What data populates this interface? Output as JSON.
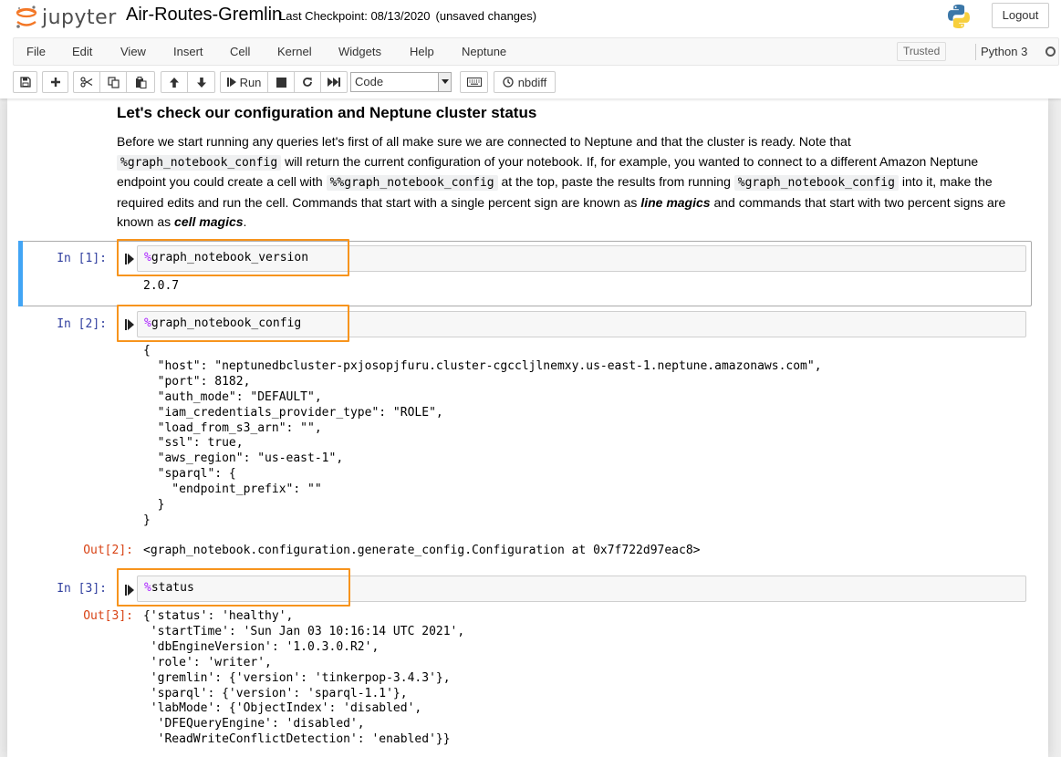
{
  "header": {
    "logo_text": "jupyter",
    "notebook_name": "Air-Routes-Gremlin",
    "checkpoint_text": "Last Checkpoint: 08/13/2020",
    "unsaved_text": "(unsaved changes)",
    "logout_label": "Logout"
  },
  "menubar": {
    "items": [
      "File",
      "Edit",
      "View",
      "Insert",
      "Cell",
      "Kernel",
      "Widgets",
      "Help",
      "Neptune"
    ],
    "trusted_label": "Trusted",
    "kernel_name": "Python 3"
  },
  "toolbar": {
    "run_label": "Run",
    "cell_type": "Code",
    "nbdiff_label": "nbdiff",
    "icons": [
      "save-icon",
      "plus-icon",
      "scissors-icon",
      "copy-icon",
      "paste-icon",
      "arrow-up-icon",
      "arrow-down-icon",
      "step-forward-icon",
      "stop-icon",
      "restart-icon",
      "fast-forward-icon",
      "keyboard-icon",
      "history-icon"
    ]
  },
  "markdown": {
    "heading": "Let's check our configuration and Neptune cluster status",
    "p1": "Before we start running any queries let's first of all make sure we are connected to Neptune and that the cluster is ready. Note that",
    "code1": "%graph_notebook_config",
    "p2": " will return the current configuration of your notebook. If, for example, you wanted to connect to a different Amazon Neptune endpoint you could create a cell with ",
    "code2": "%%graph_notebook_config",
    "p3": " at the top, paste the results from running ",
    "code3": "%graph_notebook_config",
    "p4": " into it, make the required edits and run the cell. Commands that start with a single percent sign are known as ",
    "em1": "line magics",
    "p5": " and commands that start with two percent signs are known as ",
    "em2": "cell magics",
    "p6": "."
  },
  "cells": {
    "c1": {
      "prompt": "In [1]:",
      "magic_sign": "%",
      "code": "graph_notebook_version",
      "output": "2.0.7"
    },
    "c2": {
      "prompt": "In [2]:",
      "magic_sign": "%",
      "code": "graph_notebook_config",
      "output": "{\n  \"host\": \"neptunedbcluster-pxjosopjfuru.cluster-cgccljlnemxy.us-east-1.neptune.amazonaws.com\",\n  \"port\": 8182,\n  \"auth_mode\": \"DEFAULT\",\n  \"iam_credentials_provider_type\": \"ROLE\",\n  \"load_from_s3_arn\": \"\",\n  \"ssl\": true,\n  \"aws_region\": \"us-east-1\",\n  \"sparql\": {\n    \"endpoint_prefix\": \"\"\n  }\n}",
      "out_prompt": "Out[2]:",
      "out_value": "<graph_notebook.configuration.generate_config.Configuration at 0x7f722d97eac8>"
    },
    "c3": {
      "prompt": "In [3]:",
      "magic_sign": "%",
      "code": "status",
      "out_prompt": "Out[3]:",
      "out_value": "{'status': 'healthy',\n 'startTime': 'Sun Jan 03 10:16:14 UTC 2021',\n 'dbEngineVersion': '1.0.3.0.R2',\n 'role': 'writer',\n 'gremlin': {'version': 'tinkerpop-3.4.3'},\n 'sparql': {'version': 'sparql-1.1'},\n 'labMode': {'ObjectIndex': 'disabled',\n  'DFEQueryEngine': 'disabled',\n  'ReadWriteConflictDetection': 'enabled'}}"
    }
  },
  "colors": {
    "highlight_border": "#f7941d",
    "selected_bar": "#42a5f5",
    "in_prompt": "#303f9f",
    "out_prompt": "#d84315",
    "magic": "#aa22ff"
  }
}
